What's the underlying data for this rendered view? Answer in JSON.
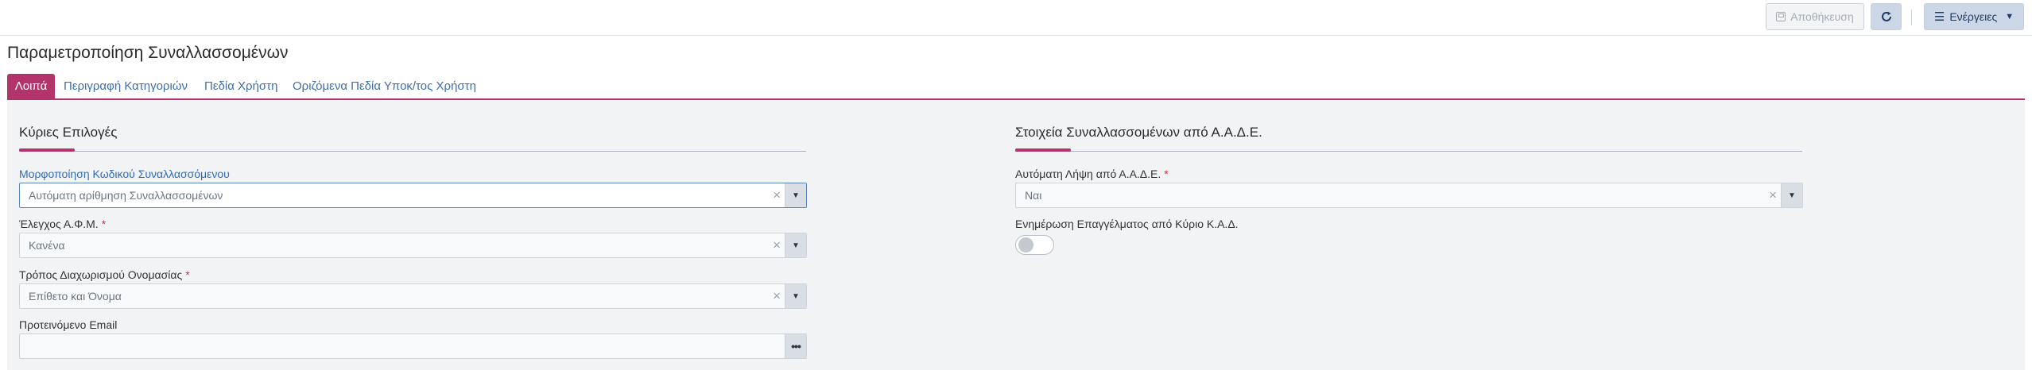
{
  "toolbar": {
    "save_label": "Αποθήκευση",
    "actions_label": "Ενέργειες"
  },
  "page": {
    "title": "Παραμετροποίηση Συναλλασσομένων"
  },
  "tabs": [
    {
      "label": "Λοιπά",
      "active": true
    },
    {
      "label": "Περιγραφή Κατηγοριών",
      "active": false
    },
    {
      "label": "Πεδία Χρήστη",
      "active": false
    },
    {
      "label": "Οριζόμενα Πεδία Υποκ/τος Χρήστη",
      "active": false
    }
  ],
  "left_section": {
    "title": "Κύριες Επιλογές",
    "fields": [
      {
        "label": "Μορφοποίηση Κωδικού Συναλλασσόμενου",
        "value": "Αυτόματη αρίθμηση Συναλλασσομένων",
        "required": false
      },
      {
        "label": "Έλεγχος Α.Φ.Μ.",
        "value": "Κανένα",
        "required": true
      },
      {
        "label": "Τρόπος Διαχωρισμού Ονομασίας",
        "value": "Επίθετο και Όνομα",
        "required": true
      },
      {
        "label": "Προτεινόμενο Email",
        "value": "",
        "required": false
      }
    ]
  },
  "right_section": {
    "title": "Στοιχεία Συναλλασσομένων από Α.Α.Δ.Ε.",
    "fields": [
      {
        "label": "Αυτόματη Λήψη από Α.Α.Δ.Ε.",
        "value": "Ναι",
        "required": true
      },
      {
        "label": "Ενημέρωση Επαγγέλματος από Κύριο Κ.Α.Δ.",
        "toggle_on": false
      }
    ]
  },
  "common": {
    "required_mark": "*",
    "clear_glyph": "×",
    "dropdown_glyph": "▼",
    "more_glyph": "•••"
  },
  "colors": {
    "accent": "#b3336b",
    "link": "#2f6db5",
    "panel_bg": "#f1f3f5",
    "button_bg": "#cbd7e6"
  },
  "icons": [
    "save-icon",
    "refresh-icon",
    "menu-icon",
    "caret-down-icon",
    "clear-icon",
    "dropdown-arrow-icon",
    "more-icon"
  ]
}
